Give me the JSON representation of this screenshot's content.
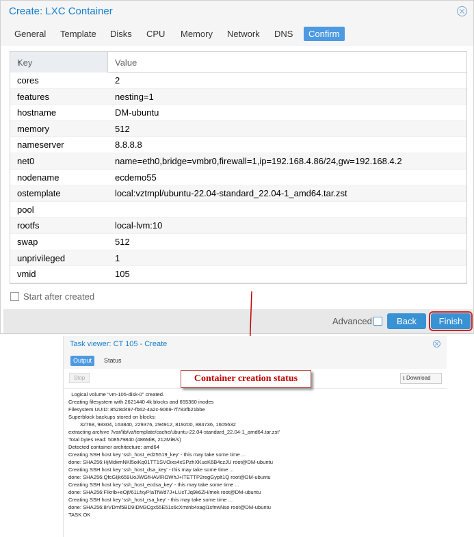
{
  "dialog": {
    "title": "Create: LXC Container",
    "tabs": [
      "General",
      "Template",
      "Disks",
      "CPU",
      "Memory",
      "Network",
      "DNS",
      "Confirm"
    ],
    "active_tab": "Confirm",
    "grid": {
      "col_key": "Key",
      "col_value": "Value",
      "sort_indicator": "↑",
      "rows": [
        {
          "key": "cores",
          "value": "2"
        },
        {
          "key": "features",
          "value": "nesting=1"
        },
        {
          "key": "hostname",
          "value": "DM-ubuntu"
        },
        {
          "key": "memory",
          "value": "512"
        },
        {
          "key": "nameserver",
          "value": "8.8.8.8"
        },
        {
          "key": "net0",
          "value": "name=eth0,bridge=vmbr0,firewall=1,ip=192.168.4.86/24,gw=192.168.4.2"
        },
        {
          "key": "nodename",
          "value": "ecdemo55"
        },
        {
          "key": "ostemplate",
          "value": "local:vztmpl/ubuntu-22.04-standard_22.04-1_amd64.tar.zst"
        },
        {
          "key": "pool",
          "value": ""
        },
        {
          "key": "rootfs",
          "value": "local-lvm:10"
        },
        {
          "key": "swap",
          "value": "512"
        },
        {
          "key": "unprivileged",
          "value": "1"
        },
        {
          "key": "vmid",
          "value": "105"
        }
      ]
    },
    "start_after_created": "Start after created",
    "advanced_label": "Advanced",
    "back_label": "Back",
    "finish_label": "Finish"
  },
  "annotation": {
    "text": "Container creation status",
    "color": "#c00000"
  },
  "task_viewer": {
    "title": "Task viewer: CT 105 - Create",
    "tabs": [
      "Output",
      "Status"
    ],
    "stop_label": "Stop",
    "download_label": "Download",
    "log": [
      "  Logical volume \"vm-105-disk-0\" created.",
      "Creating filesystem with 2621440 4k blocks and 655360 inodes",
      "Filesystem UUID: 8528d497-fb62-4a2c-9069-7f783fb21bbe",
      "Superblock backups stored on blocks:",
      "        32768, 98304, 163840, 229376, 294912, 819200, 884736, 1605632",
      "extracting archive '/var/lib/vz/template/cache/ubuntu-22.04-standard_22.04-1_amd64.tar.zst'",
      "Total bytes read: 508579840 (486MiB, 212MiB/s)",
      "Detected container architecture: amd64",
      "Creating SSH host key 'ssh_host_ed25519_key' - this may take some time ...",
      "done: SHA256:HjMdxmNKl5oiKq01TT1SVOixs4xSPzhXKuoK6B4czJU root@DM-ubuntu",
      "Creating SSH host key 'ssh_host_dsa_key' - this may take some time ...",
      "done: SHA256:QfcGIjk659UoJWGfHAVlROWhJ+ITETTP2regGyplt1Q root@DM-ubuntu",
      "Creating SSH host key 'ssh_host_ecdsa_key' - this may take some time ...",
      "done: SHA256:FIkrIb+eOjf/61LfxyP/aTfWd7J+LUcTJq9k6ZH/mek root@DM-ubuntu",
      "Creating SSH host key 'ssh_host_rsa_key' - this may take some time ...",
      "done: SHA256:8rVDmf5BD9IDM3Cgx55E51s6cXmtnb4xagI1sfnwNso root@DM-ubuntu",
      "TASK OK"
    ]
  },
  "colors": {
    "accent": "#157fcc",
    "button": "#3892d4",
    "highlight_border": "#d32020"
  }
}
